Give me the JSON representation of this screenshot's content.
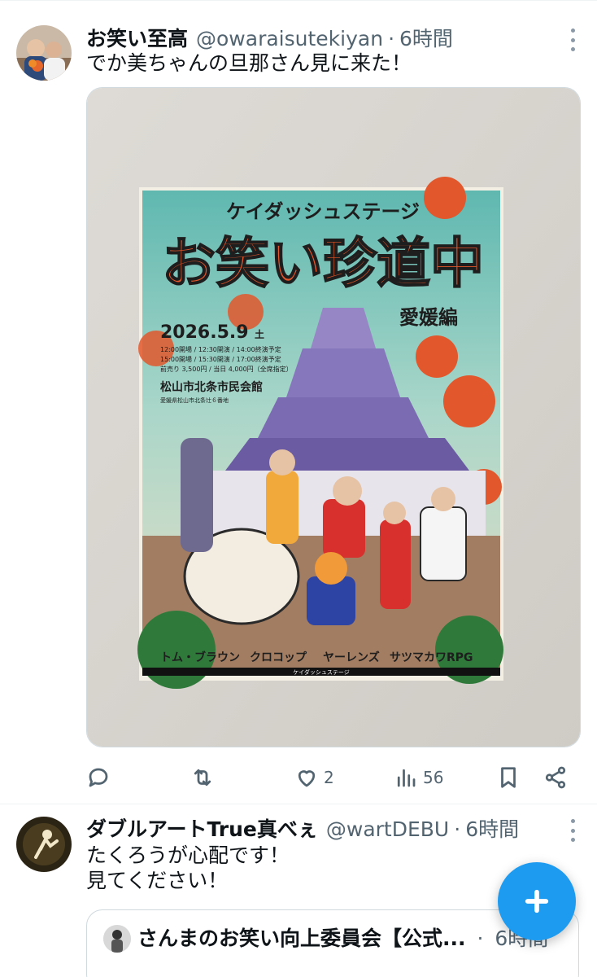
{
  "tweets": [
    {
      "author_name": "お笑い至高",
      "handle": "@owaraisutekiyan",
      "separator": "·",
      "time": "6時間",
      "text": "でか美ちゃんの旦那さん見に来た！",
      "poster": {
        "subtitle": "ケイダッシュステージ",
        "title": "お笑い珍道中",
        "edition": "愛媛編",
        "date": "2026.5.9",
        "weekday": "土",
        "show1": "12:00開場 / 12:30開演 / 14:00終演予定",
        "show2": "15:00開場 / 15:30開演 / 17:00終演予定",
        "price": "前売り 3,500円 / 当日 4,000円（全席指定）",
        "venue": "松山市北条市民会館",
        "address": "愛媛県松山市北条辻６番地",
        "performers": [
          "トム・ブラウン",
          "クロコップ",
          "ヤーレンズ",
          "サツマカワRPG"
        ],
        "footer": "ケイダッシュステージ"
      },
      "reply_count": "",
      "retweet_count": "",
      "like_count": "2",
      "view_count": "56"
    },
    {
      "author_name": "ダブルアートTrue真べぇ",
      "handle": "@wartDEBU",
      "separator": "·",
      "time": "6時間",
      "text_line1": "たくろうが心配です！",
      "text_line2": "見てください！",
      "quote": {
        "author_name": "さんまのお笑い向上委員会【公式...",
        "separator": "·",
        "time": "6時間"
      }
    }
  ],
  "colors": {
    "accent": "#1d9bf0",
    "text_primary": "#0f1419",
    "text_secondary": "#536471",
    "border": "#cfd9de"
  },
  "icons": [
    "reply-icon",
    "retweet-icon",
    "like-icon",
    "views-icon",
    "bookmark-icon",
    "share-icon",
    "more-icon",
    "compose-plus-icon"
  ]
}
